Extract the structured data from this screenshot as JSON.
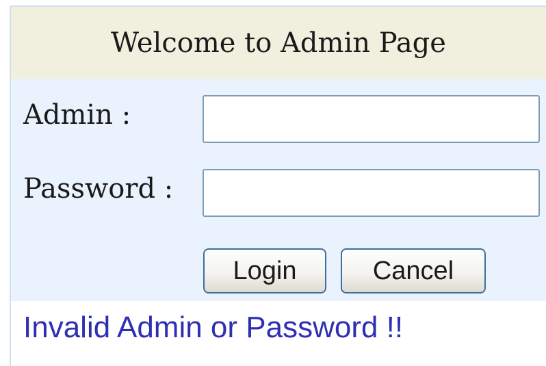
{
  "header": {
    "title": "Welcome to Admin Page"
  },
  "form": {
    "admin_label": "Admin :",
    "admin_value": "",
    "password_label": "Password :",
    "password_value": "",
    "login_label": "Login",
    "cancel_label": "Cancel"
  },
  "status": {
    "message": "Invalid Admin or Password !!"
  },
  "colors": {
    "header_bg": "#f1efde",
    "form_bg": "#eaf3fd",
    "error_text": "#2f2fb3"
  }
}
